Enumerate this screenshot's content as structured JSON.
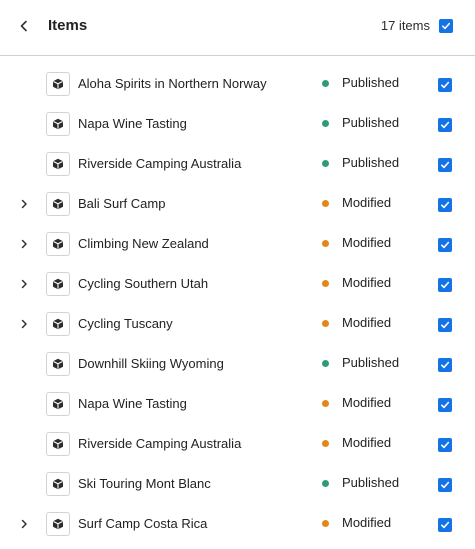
{
  "header": {
    "title": "Items",
    "count_label": "17 items",
    "select_all_checked": true
  },
  "colors": {
    "published": "#2d9d78",
    "modified": "#e68619",
    "checkbox": "#1473e6"
  },
  "icons": {
    "back": "chevron-left-icon",
    "expand": "chevron-right-icon",
    "item": "cube-icon"
  },
  "items": [
    {
      "name": "Aloha Spirits in Northern Norway",
      "status": "Published",
      "expandable": false,
      "checked": true
    },
    {
      "name": "Napa Wine Tasting",
      "status": "Published",
      "expandable": false,
      "checked": true
    },
    {
      "name": "Riverside Camping Australia",
      "status": "Published",
      "expandable": false,
      "checked": true
    },
    {
      "name": "Bali Surf Camp",
      "status": "Modified",
      "expandable": true,
      "checked": true
    },
    {
      "name": "Climbing New Zealand",
      "status": "Modified",
      "expandable": true,
      "checked": true
    },
    {
      "name": "Cycling Southern Utah",
      "status": "Modified",
      "expandable": true,
      "checked": true
    },
    {
      "name": "Cycling Tuscany",
      "status": "Modified",
      "expandable": true,
      "checked": true
    },
    {
      "name": "Downhill Skiing Wyoming",
      "status": "Published",
      "expandable": false,
      "checked": true
    },
    {
      "name": "Napa Wine Tasting",
      "status": "Modified",
      "expandable": false,
      "checked": true
    },
    {
      "name": "Riverside Camping Australia",
      "status": "Modified",
      "expandable": false,
      "checked": true
    },
    {
      "name": "Ski Touring Mont Blanc",
      "status": "Published",
      "expandable": false,
      "checked": true
    },
    {
      "name": "Surf Camp Costa Rica",
      "status": "Modified",
      "expandable": true,
      "checked": true
    }
  ]
}
